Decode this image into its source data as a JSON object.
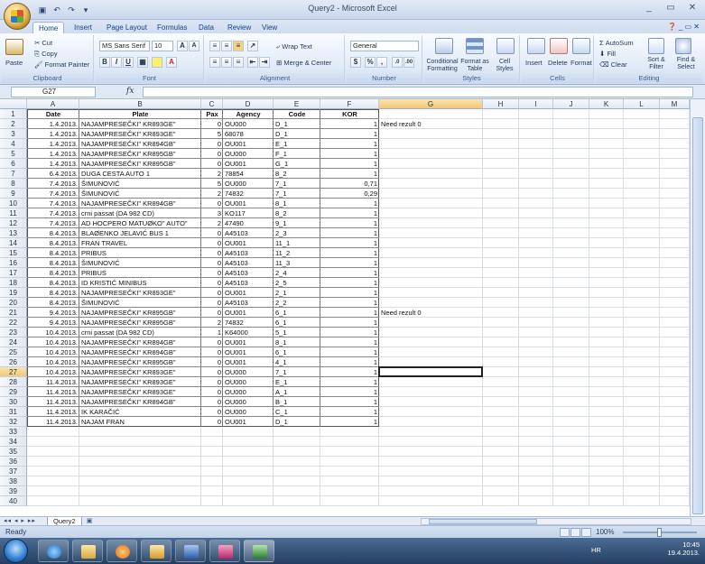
{
  "window": {
    "title": "Query2 - Microsoft Excel",
    "controls": [
      "_",
      "▭",
      "✕"
    ]
  },
  "ribbon": {
    "tabs": [
      "Home",
      "Insert",
      "Page Layout",
      "Formulas",
      "Data",
      "Review",
      "View"
    ],
    "active_tab": "Home",
    "clipboard": {
      "paste": "Paste",
      "cut": "Cut",
      "copy": "Copy",
      "format_painter": "Format Painter",
      "label": "Clipboard"
    },
    "font": {
      "name": "MS Sans Serif",
      "size": "10",
      "label": "Font",
      "bold": "B",
      "italic": "I",
      "underline": "U"
    },
    "alignment": {
      "wrap": "Wrap Text",
      "merge": "Merge & Center",
      "label": "Alignment"
    },
    "number": {
      "format": "General",
      "label": "Number",
      "percent": "%",
      "comma": ","
    },
    "styles": {
      "conditional": "Conditional Formatting",
      "format_table": "Format as Table",
      "cell_styles": "Cell Styles",
      "label": "Styles"
    },
    "cells": {
      "insert": "Insert",
      "delete": "Delete",
      "format": "Format",
      "label": "Cells"
    },
    "editing": {
      "autosum": "AutoSum",
      "fill": "Fill",
      "clear": "Clear",
      "sort": "Sort & Filter",
      "find": "Find & Select",
      "label": "Editing"
    }
  },
  "formula_bar": {
    "name_box": "G27",
    "fx": "fx",
    "value": ""
  },
  "columns": [
    "A",
    "B",
    "C",
    "D",
    "E",
    "F",
    "G",
    "H",
    "I",
    "J",
    "K",
    "L",
    "M"
  ],
  "selected_column": "G",
  "selected_row": 27,
  "header_row": {
    "date": "Date",
    "plate": "Plate",
    "pax": "Pax",
    "agency": "Agency",
    "code": "Code",
    "kor": "KOR"
  },
  "rows": [
    {
      "date": "1.4.2013.",
      "plate": "NAJAMPRESEČKI\" KR893GE\"",
      "pax": "0",
      "agency": "OU000",
      "code": "D_1",
      "kor": "1",
      "g": "Need rezult 0"
    },
    {
      "date": "1.4.2013.",
      "plate": "NAJAMPRESEČKI\" KR893GE\"",
      "pax": "5",
      "agency": "68078",
      "code": "D_1",
      "kor": "1",
      "g": ""
    },
    {
      "date": "1.4.2013.",
      "plate": "NAJAMPRESEČKI\" KR894GB\"",
      "pax": "0",
      "agency": "OU001",
      "code": "E_1",
      "kor": "1",
      "g": ""
    },
    {
      "date": "1.4.2013.",
      "plate": "NAJAMPRESEČKI\" KR895GB\"",
      "pax": "0",
      "agency": "OU000",
      "code": "F_1",
      "kor": "1",
      "g": ""
    },
    {
      "date": "1.4.2013.",
      "plate": "NAJAMPRESEČKI\" KR895GB\"",
      "pax": "0",
      "agency": "OU001",
      "code": "G_1",
      "kor": "1",
      "g": ""
    },
    {
      "date": "6.4.2013.",
      "plate": "DUGA CESTA AUTO 1",
      "pax": "2",
      "agency": "78854",
      "code": "8_2",
      "kor": "1",
      "g": ""
    },
    {
      "date": "7.4.2013.",
      "plate": "ŠIMUNOVIĆ",
      "pax": "5",
      "agency": "OU000",
      "code": "7_1",
      "kor": "0,71",
      "g": ""
    },
    {
      "date": "7.4.2013.",
      "plate": "ŠIMUNOVIĆ",
      "pax": "2",
      "agency": "74832",
      "code": "7_1",
      "kor": "0,29",
      "g": ""
    },
    {
      "date": "7.4.2013.",
      "plate": "NAJAMPRESEČKI\" KR894GB\"",
      "pax": "0",
      "agency": "OU001",
      "code": "8_1",
      "kor": "1",
      "g": ""
    },
    {
      "date": "7.4.2013.",
      "plate": "crni passat (DA 982 CD)",
      "pax": "3",
      "agency": "KO117",
      "code": "8_2",
      "kor": "1",
      "g": ""
    },
    {
      "date": "7.4.2013.",
      "plate": "AD HOCPERO MATUØKO\" AUTO\"",
      "pax": "2",
      "agency": "47490",
      "code": "9_1",
      "kor": "1",
      "g": ""
    },
    {
      "date": "8.4.2013.",
      "plate": "BLAØENKO JELAVIĆ BUS 1",
      "pax": "0",
      "agency": "A45103",
      "code": "2_3",
      "kor": "1",
      "g": ""
    },
    {
      "date": "8.4.2013.",
      "plate": "FRAN TRAVEL",
      "pax": "0",
      "agency": "OU001",
      "code": "11_1",
      "kor": "1",
      "g": ""
    },
    {
      "date": "8.4.2013.",
      "plate": "PRIBUS",
      "pax": "0",
      "agency": "A45103",
      "code": "11_2",
      "kor": "1",
      "g": ""
    },
    {
      "date": "8.4.2013.",
      "plate": "ŠIMUNOVIĆ",
      "pax": "0",
      "agency": "A45103",
      "code": "11_3",
      "kor": "1",
      "g": ""
    },
    {
      "date": "8.4.2013.",
      "plate": "PRIBUS",
      "pax": "0",
      "agency": "A45103",
      "code": "2_4",
      "kor": "1",
      "g": ""
    },
    {
      "date": "8.4.2013.",
      "plate": "ID KRISTIĆ MINIBUS",
      "pax": "0",
      "agency": "A45103",
      "code": "2_5",
      "kor": "1",
      "g": ""
    },
    {
      "date": "8.4.2013.",
      "plate": "NAJAMPRESEČKI\" KR893GE\"",
      "pax": "0",
      "agency": "OU001",
      "code": "2_1",
      "kor": "1",
      "g": ""
    },
    {
      "date": "8.4.2013.",
      "plate": "ŠIMUNOVIĆ",
      "pax": "0",
      "agency": "A45103",
      "code": "2_2",
      "kor": "1",
      "g": ""
    },
    {
      "date": "9.4.2013.",
      "plate": "NAJAMPRESEČKI\" KR895GB\"",
      "pax": "0",
      "agency": "OU001",
      "code": "6_1",
      "kor": "1",
      "g": "Need rezult 0"
    },
    {
      "date": "9.4.2013.",
      "plate": "NAJAMPRESEČKI\" KR895GB\"",
      "pax": "2",
      "agency": "74832",
      "code": "6_1",
      "kor": "1",
      "g": ""
    },
    {
      "date": "10.4.2013.",
      "plate": "crni passat (DA 982 CD)",
      "pax": "1",
      "agency": "K64000",
      "code": "5_1",
      "kor": "1",
      "g": ""
    },
    {
      "date": "10.4.2013.",
      "plate": "NAJAMPRESEČKI\" KR894GB\"",
      "pax": "0",
      "agency": "OU001",
      "code": "8_1",
      "kor": "1",
      "g": ""
    },
    {
      "date": "10.4.2013.",
      "plate": "NAJAMPRESEČKI\" KR894GB\"",
      "pax": "0",
      "agency": "OU001",
      "code": "6_1",
      "kor": "1",
      "g": ""
    },
    {
      "date": "10.4.2013.",
      "plate": "NAJAMPRESEČKI\" KR895GB\"",
      "pax": "0",
      "agency": "OU001",
      "code": "4_1",
      "kor": "1",
      "g": ""
    },
    {
      "date": "10.4.2013.",
      "plate": "NAJAMPRESEČKI\" KR893GE\"",
      "pax": "0",
      "agency": "OU000",
      "code": "7_1",
      "kor": "1",
      "g": ""
    },
    {
      "date": "11.4.2013.",
      "plate": "NAJAMPRESEČKI\" KR893GE\"",
      "pax": "0",
      "agency": "OU000",
      "code": "E_1",
      "kor": "1",
      "g": ""
    },
    {
      "date": "11.4.2013.",
      "plate": "NAJAMPRESEČKI\" KR893GE\"",
      "pax": "0",
      "agency": "OU000",
      "code": "A_1",
      "kor": "1",
      "g": ""
    },
    {
      "date": "11.4.2013.",
      "plate": "NAJAMPRESEČKI\" KR894GB\"",
      "pax": "0",
      "agency": "OU000",
      "code": "B_1",
      "kor": "1",
      "g": ""
    },
    {
      "date": "11.4.2013.",
      "plate": "IK KARAČIĆ",
      "pax": "0",
      "agency": "OU000",
      "code": "C_1",
      "kor": "1",
      "g": ""
    },
    {
      "date": "11.4.2013.",
      "plate": "NAJAM FRAN",
      "pax": "0",
      "agency": "OU001",
      "code": "D_1",
      "kor": "1",
      "g": ""
    }
  ],
  "row_numbers": [
    "1",
    "2",
    "3",
    "4",
    "5",
    "6",
    "7",
    "8",
    "9",
    "10",
    "11",
    "12",
    "13",
    "14",
    "15",
    "16",
    "17",
    "18",
    "19",
    "20",
    "21",
    "22",
    "23",
    "24",
    "25",
    "26",
    "27",
    "28",
    "29",
    "30",
    "31",
    "32",
    "33",
    "34",
    "35",
    "36",
    "37",
    "38",
    "39",
    "40"
  ],
  "sheet_tab": "Query2",
  "status": {
    "text": "Ready",
    "zoom": "100%"
  },
  "taskbar": {
    "lang": "HR",
    "time": "10:45",
    "date": "19.4.2013."
  }
}
